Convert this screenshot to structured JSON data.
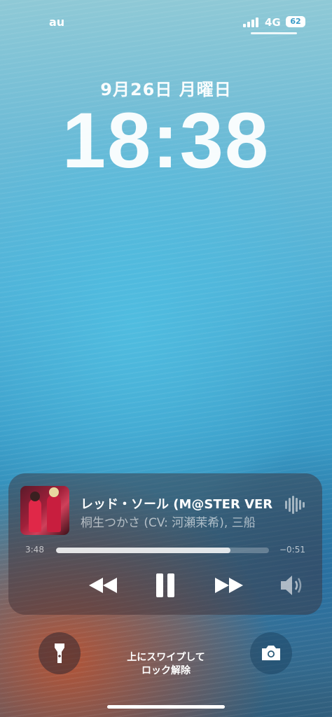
{
  "status_bar": {
    "carrier": "au",
    "network": "4G",
    "battery": "62",
    "signal_bars": 4
  },
  "lock": {
    "date": "9月26日 月曜日",
    "time": "18:38"
  },
  "now_playing": {
    "title": "レッド・ソール (M@STER VER",
    "artist": "桐生つかさ (CV: 河瀬茉希), 三船",
    "elapsed": "3:48",
    "remaining": "−0:51",
    "progress": 0.82
  },
  "icons": {
    "rewind": "rewind-icon",
    "pause": "pause-icon",
    "forward": "fast-forward-icon",
    "volume": "speaker-icon",
    "flashlight": "flashlight-icon",
    "camera": "camera-icon",
    "waveform": "waveform-icon"
  },
  "hint": {
    "line1": "上にスワイプして",
    "line2": "ロック解除"
  },
  "colors": {
    "accent": "#ffffff"
  }
}
